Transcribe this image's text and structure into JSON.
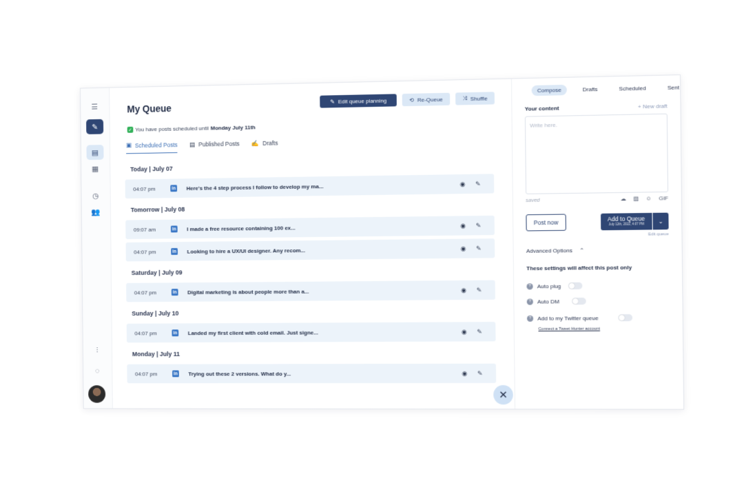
{
  "rail": {
    "icons": [
      "menu-icon",
      "pencil-icon",
      "queue-icon",
      "calendar-icon",
      "clock-icon",
      "users-icon",
      "sliders-icon",
      "chat-icon"
    ]
  },
  "header": {
    "title": "My Queue",
    "edit_label": "Edit queue planning",
    "requeue_label": "Re-Queue",
    "shuffle_label": "Shuffle"
  },
  "status": {
    "prefix": "You have posts scheduled until",
    "date": "Monday July 11th"
  },
  "tabs": [
    {
      "label": "Scheduled Posts"
    },
    {
      "label": "Published Posts"
    },
    {
      "label": "Drafts"
    }
  ],
  "queue": [
    {
      "day": "Today | July 07",
      "posts": [
        {
          "time": "04:07 pm",
          "text": "Here's the 4 step process I follow to develop my ma..."
        }
      ]
    },
    {
      "day": "Tomorrow | July 08",
      "posts": [
        {
          "time": "09:07 am",
          "text": "I made a free resource containing 100 ex..."
        },
        {
          "time": "04:07 pm",
          "text": "Looking to hire a UX/UI designer. Any recom..."
        }
      ]
    },
    {
      "day": "Saturday | July 09",
      "posts": [
        {
          "time": "04:07 pm",
          "text": "Digital marketing is about people more than a..."
        }
      ]
    },
    {
      "day": "Sunday | July 10",
      "posts": [
        {
          "time": "04:07 pm",
          "text": "Landed my first client with cold email. Just signe..."
        }
      ]
    },
    {
      "day": "Monday | July 11",
      "posts": [
        {
          "time": "04:07 pm",
          "text": "Trying out these 2 versions. What do y..."
        }
      ]
    }
  ],
  "composer": {
    "tabs": [
      "Compose",
      "Drafts",
      "Scheduled",
      "Sent"
    ],
    "content_label": "Your content",
    "new_draft": "+ New draft",
    "placeholder": "Write here.",
    "saved": "saved",
    "gif": "GIF",
    "post_now": "Post now",
    "add_queue": "Add to Queue",
    "add_queue_sub": "July 12th, 2022, 4:07 PM",
    "edit_queue": "Edit queue",
    "advanced": "Advanced Options",
    "note": "These settings will affect this post only",
    "options": [
      "Auto plug",
      "Auto DM",
      "Add to my Twitter queue"
    ],
    "connect": "Connect a Tweet Hunter account"
  },
  "colors": {
    "accent": "#2f4674",
    "light": "#dbe8f6",
    "row": "#ecf3fa",
    "linkedin": "#3b78c6"
  }
}
